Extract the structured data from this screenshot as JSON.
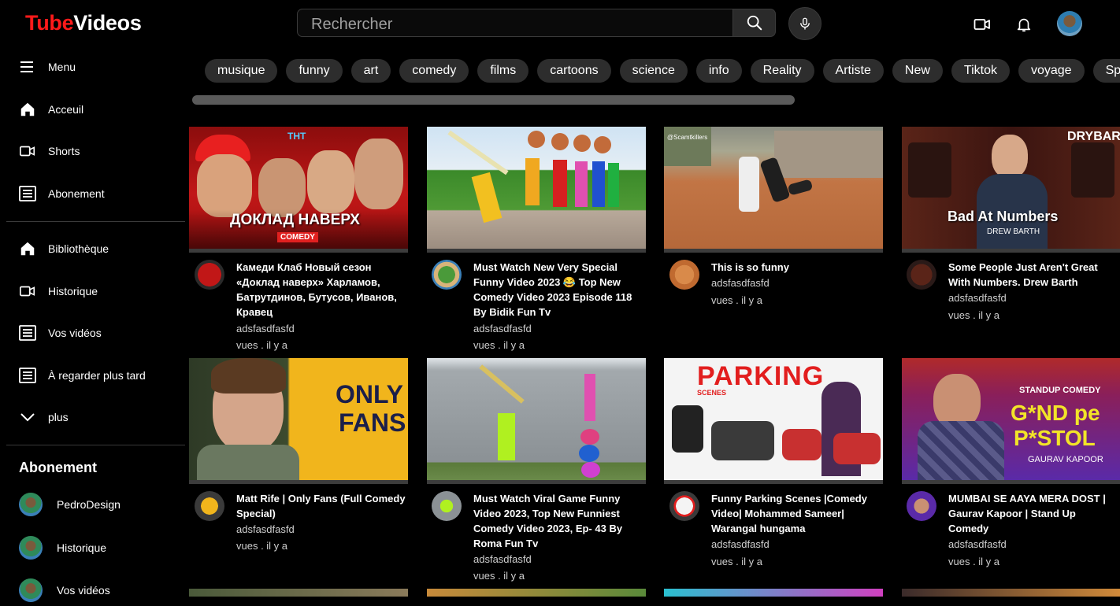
{
  "header": {
    "logo_part1": "Tube",
    "logo_part2": "Videos",
    "search_placeholder": "Rechercher",
    "icons": [
      "search-icon",
      "microphone-icon",
      "video-camera-icon",
      "bell-icon",
      "avatar"
    ]
  },
  "sidebar": {
    "menu_label": "Menu",
    "items": [
      {
        "label": "Acceuil",
        "icon": "home-icon"
      },
      {
        "label": "Shorts",
        "icon": "video-camera-icon"
      },
      {
        "label": "Abonement",
        "icon": "list-icon"
      },
      {
        "label": "Bibliothèque",
        "icon": "home-icon"
      },
      {
        "label": "Historique",
        "icon": "video-camera-icon"
      },
      {
        "label": "Vos vidéos",
        "icon": "list-icon"
      },
      {
        "label": "À regarder plus tard",
        "icon": "list-icon"
      },
      {
        "label": "plus",
        "icon": "chevron-down-icon"
      }
    ],
    "subscriptions_title": "Abonement",
    "subscriptions": [
      {
        "label": "PedroDesign"
      },
      {
        "label": "Historique"
      },
      {
        "label": "Vos vidéos"
      }
    ]
  },
  "chips": [
    "musique",
    "funny",
    "art",
    "comedy",
    "films",
    "cartoons",
    "science",
    "info",
    "Reality",
    "Artiste",
    "New",
    "Tiktok",
    "voyage",
    "Sp"
  ],
  "videos": [
    {
      "title": "Камеди Клаб Новый сезон «Доклад наверх» Харламов, Батрутдинов, Бутусов, Иванов, Кравец",
      "channel": "adsfasdfasfd",
      "meta": "vues . il y a",
      "thumb_caption": "ДОКЛАД НАВЕРХ",
      "thumb_badge": "COMEDY",
      "thumb_logo": "ТНТ"
    },
    {
      "title": "Must Watch New Very Special Funny Video 2023 😂 Top New Comedy Video 2023 Episode 118 By Bidik Fun Tv",
      "channel": "adsfasdfasfd",
      "meta": "vues . il y a"
    },
    {
      "title": "This is so funny",
      "channel": "adsfasdfasfd",
      "meta": "vues . il y a",
      "thumb_watermark": "@Scamtkillers"
    },
    {
      "title": "Some People Just Aren't Great With Numbers. Drew Barth",
      "channel": "adsfasdfasfd",
      "meta": "vues . il y a",
      "thumb_caption": "Bad At Numbers",
      "thumb_sub": "DREW BARTH",
      "thumb_logo": "DRYBAR"
    },
    {
      "title": "Matt Rife | Only Fans (Full Comedy Special)",
      "channel": "adsfasdfasfd",
      "meta": "vues . il y a",
      "thumb_caption_1": "ONLY",
      "thumb_caption_2": "FANS"
    },
    {
      "title": "Must Watch Viral Game Funny Video 2023, Top New Funniest Comedy Video 2023, Ep- 43 By Roma Fun Tv",
      "channel": "adsfasdfasfd",
      "meta": "vues . il y a"
    },
    {
      "title": "Funny Parking Scenes |Comedy Video| Mohammed Sameer| Warangal hungama",
      "channel": "adsfasdfasfd",
      "meta": "vues . il y a",
      "thumb_caption": "PARKING",
      "thumb_sub": "SCENES"
    },
    {
      "title": "MUMBAI SE AAYA MERA DOST | Gaurav Kapoor | Stand Up Comedy",
      "channel": "adsfasdfasfd",
      "meta": "vues . il y a",
      "thumb_top": "STANDUP COMEDY",
      "thumb_caption_1": "G*ND pe",
      "thumb_caption_2": "P*STOL",
      "thumb_sub": "GAURAV KAPOOR"
    }
  ]
}
